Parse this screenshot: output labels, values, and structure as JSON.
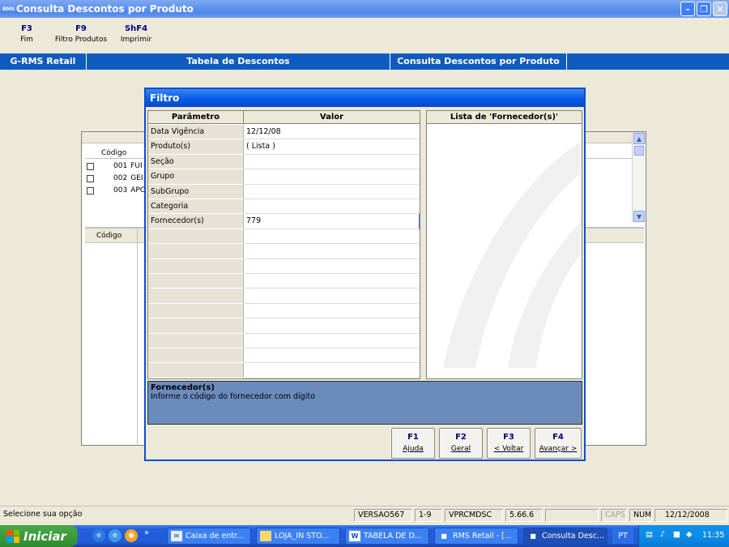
{
  "window": {
    "title": "Consulta Descontos por Produto",
    "icon": "RMS"
  },
  "fkeys": [
    {
      "key": "F3",
      "label": "Fim"
    },
    {
      "key": "F9",
      "label": "Filtro Produtos"
    },
    {
      "key": "ShF4",
      "label": "Imprimir"
    }
  ],
  "header": {
    "left": "G-RMS Retail",
    "middle": "Tabela de Descontos",
    "right": "Consulta Descontos por Produto"
  },
  "background": {
    "code_header": "Código",
    "rows": [
      {
        "code": "001",
        "name": "FUI"
      },
      {
        "code": "002",
        "name": "GEI"
      },
      {
        "code": "003",
        "name": "APC"
      }
    ],
    "lower_code_header": "Código"
  },
  "dialog": {
    "title": "Filtro",
    "param_header": "Parâmetro",
    "value_header": "Valor",
    "list_header": "Lista de 'Fornecedor(s)'",
    "params": [
      {
        "name": "Data Vigência",
        "value": "12/12/08"
      },
      {
        "name": "Produto(s)",
        "value": "( Lista )"
      },
      {
        "name": "Seção",
        "value": ""
      },
      {
        "name": "Grupo",
        "value": ""
      },
      {
        "name": "SubGrupo",
        "value": ""
      },
      {
        "name": "Categoria",
        "value": ""
      },
      {
        "name": "Fornecedor(s)",
        "value": "779"
      }
    ],
    "hint_title": "Fornecedor(s)",
    "hint_text": "Informe o código do fornecedor com dígito",
    "buttons": [
      {
        "key": "F1",
        "label": "Ajuda"
      },
      {
        "key": "F2",
        "label": "Geral"
      },
      {
        "key": "F3",
        "label": "< Voltar"
      },
      {
        "key": "F4",
        "label": "Avançar >"
      }
    ]
  },
  "statusbar": {
    "message": "Selecione sua opção",
    "version": "VERSAO567",
    "page": "1-9",
    "program": "VPRCMDSC",
    "build": "5.66.6",
    "caps": "CAPS",
    "num": "NUM",
    "date": "12/12/2008"
  },
  "taskbar": {
    "start": "Iniciar",
    "tasks": [
      "Caixa de entr...",
      "LOJA_IN STO...",
      "TABELA DE D...",
      "RMS Retail - [...",
      "Consulta Desc..."
    ],
    "lang": "PT",
    "clock": "11:35"
  }
}
